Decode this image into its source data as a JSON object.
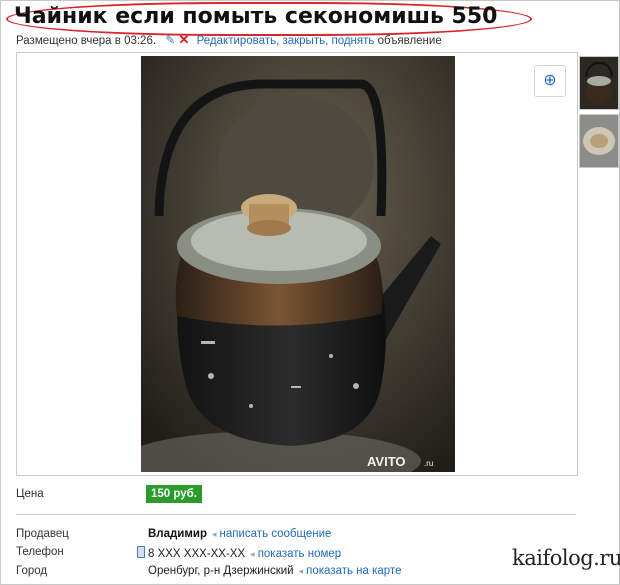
{
  "title": "Чайник если помыть секономишь 550",
  "meta": {
    "posted": "Размещено вчера в 03:26.",
    "actions": "Редактировать, закрыть, поднять",
    "suffix": "объявление"
  },
  "photo": {
    "watermark": "AVITO",
    "watermark_suffix": ".ru"
  },
  "price": {
    "label": "Цена",
    "value": "150 руб."
  },
  "seller": {
    "label": "Продавец",
    "name": "Владимир",
    "link": "написать сообщение"
  },
  "phone": {
    "label": "Телефон",
    "value": "8 XXX XXX-XX-XX",
    "link": "показать номер"
  },
  "city": {
    "label": "Город",
    "value": "Оренбург, р-н Дзержинский",
    "link": "показать на карте"
  },
  "site_watermark": "kaifolog.ru",
  "colors": {
    "price_bg": "#2a9c2a",
    "link": "#2369b8",
    "title_oval": "#d8262b"
  },
  "icons": [
    "pencil-icon",
    "delete-icon",
    "zoom-in-icon",
    "phone-icon"
  ]
}
